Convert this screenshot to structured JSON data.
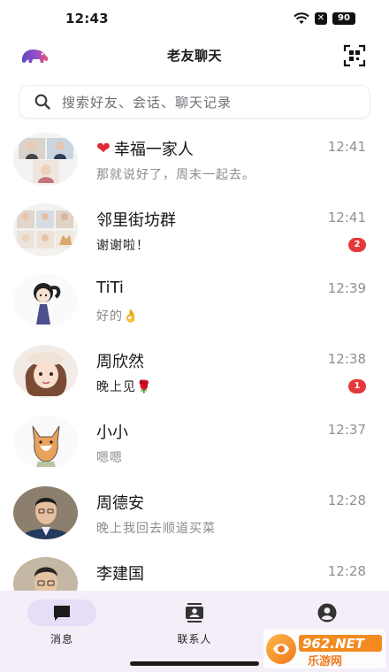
{
  "status_bar": {
    "time": "12:43",
    "battery": "90"
  },
  "header": {
    "title": "老友聊天",
    "logo_icon": "elephant-logo-icon",
    "scan_icon": "qr-scan-icon"
  },
  "search": {
    "placeholder": "搜索好友、会话、聊天记录",
    "icon": "search-icon"
  },
  "chats": [
    {
      "name": "幸福一家人",
      "name_prefix": "❤",
      "time": "12:41",
      "preview": "那就说好了，周末一起去。",
      "badge": "",
      "unread": false
    },
    {
      "name": "邻里街坊群",
      "time": "12:41",
      "preview": "谢谢啦！",
      "badge": "2",
      "unread": true
    },
    {
      "name": "TiTi",
      "time": "12:39",
      "preview": "好的👌",
      "badge": "",
      "unread": false
    },
    {
      "name": "周欣然",
      "time": "12:38",
      "preview": "晚上见🌹",
      "badge": "1",
      "unread": true
    },
    {
      "name": "小小",
      "time": "12:37",
      "preview": "嗯嗯",
      "badge": "",
      "unread": false
    },
    {
      "name": "周德安",
      "time": "12:28",
      "preview": "晚上我回去顺道买菜",
      "badge": "",
      "unread": false
    },
    {
      "name": "李建国",
      "time": "12:28",
      "preview": "",
      "badge": "",
      "unread": false
    }
  ],
  "tabs": [
    {
      "label": "消息",
      "icon": "message-icon",
      "active": true
    },
    {
      "label": "联系人",
      "icon": "contacts-icon",
      "active": false
    },
    {
      "label": "",
      "icon": "profile-icon",
      "active": false
    }
  ],
  "watermark": {
    "brand": "962.NET",
    "sub": "乐游网"
  },
  "colors": {
    "accent": "#e6ddf7",
    "tab_bar_bg": "#f3eef8",
    "badge": "#e5383b"
  }
}
